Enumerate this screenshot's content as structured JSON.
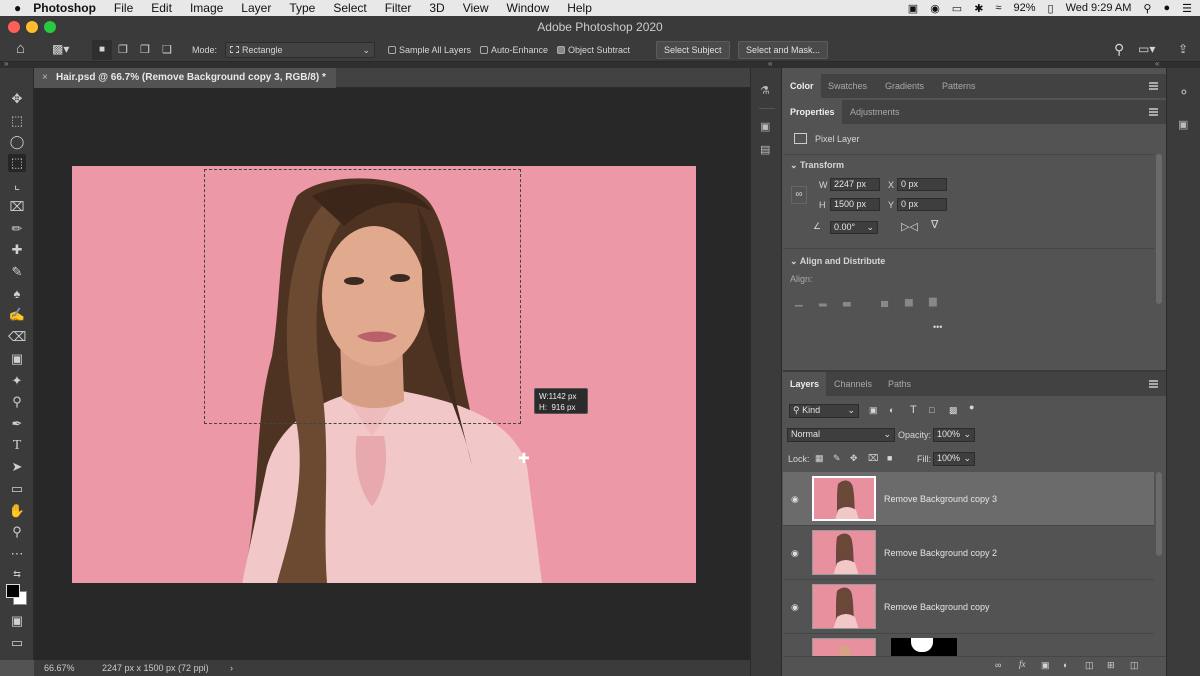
{
  "menubar": {
    "apple": "",
    "app": "Photoshop",
    "items": [
      "File",
      "Edit",
      "Image",
      "Layer",
      "Type",
      "Select",
      "Filter",
      "3D",
      "View",
      "Window",
      "Help"
    ],
    "battery": "92%",
    "clock": "Wed 9:29 AM"
  },
  "window": {
    "title": "Adobe Photoshop 2020"
  },
  "options": {
    "mode_label": "Mode:",
    "mode_value": "Rectangle",
    "sample_all_layers": "Sample All Layers",
    "auto_enhance": "Auto-Enhance",
    "object_subtract": "Object Subtract",
    "select_subject": "Select Subject",
    "select_and_mask": "Select and Mask..."
  },
  "document": {
    "tab_title": "Hair.psd @ 66.7% (Remove Background copy 3, RGB/8) *",
    "selection_tooltip_w": "W:1142 px",
    "selection_tooltip_h": "H:  916 px"
  },
  "status": {
    "zoom": "66.67%",
    "doc_size": "2247 px x 1500 px (72 ppi)",
    "arrow": "›"
  },
  "color_panel": {
    "tabs": [
      "Color",
      "Swatches",
      "Gradients",
      "Patterns"
    ]
  },
  "properties_panel": {
    "tabs": [
      "Properties",
      "Adjustments"
    ],
    "layer_type": "Pixel Layer",
    "transform_title": "Transform",
    "w_label": "W",
    "w_value": "2247 px",
    "x_label": "X",
    "x_value": "0 px",
    "h_label": "H",
    "h_value": "1500 px",
    "y_label": "Y",
    "y_value": "0 px",
    "angle_value": "0.00°",
    "align_title": "Align and Distribute",
    "align_label": "Align:",
    "more": "•••"
  },
  "layers_panel": {
    "tabs": [
      "Layers",
      "Channels",
      "Paths"
    ],
    "filter_kind": "Kind",
    "blend_mode": "Normal",
    "opacity_label": "Opacity:",
    "opacity_value": "100%",
    "lock_label": "Lock:",
    "fill_label": "Fill:",
    "fill_value": "100%",
    "layers": [
      {
        "name": "Remove Background copy 3",
        "selected": true
      },
      {
        "name": "Remove Background copy 2",
        "selected": false
      },
      {
        "name": "Remove Background copy",
        "selected": false
      }
    ]
  },
  "colors": {
    "photo_bg": "#e9909f",
    "panel": "#535353",
    "chrome": "#3b3b3b"
  }
}
